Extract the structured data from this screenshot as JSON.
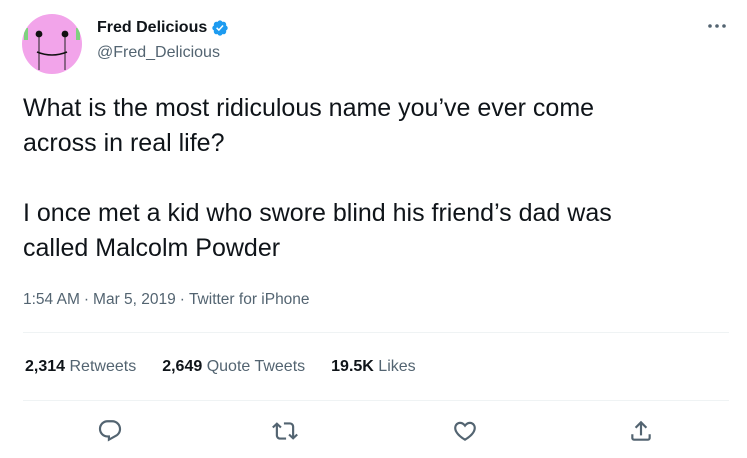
{
  "tweet": {
    "author": {
      "display_name": "Fred Delicious",
      "handle": "@Fred_Delicious",
      "verified": true,
      "avatar_icon": "pink-smiley-face-avatar"
    },
    "text": {
      "paragraph1": "What is the most ridiculous name you’ve ever come\nacross in real life?",
      "paragraph2": "I once met a kid who swore blind his friend’s dad was\ncalled Malcolm Powder"
    },
    "meta": {
      "time": "1:54 AM",
      "separator": "·",
      "date": "Mar 5, 2019",
      "source": "Twitter for iPhone"
    },
    "stats": {
      "retweets_count": "2,314",
      "retweets_label": "Retweets",
      "quote_tweets_count": "2,649",
      "quote_tweets_label": "Quote Tweets",
      "likes_count": "19.5K",
      "likes_label": "Likes"
    },
    "actions": [
      "reply-icon",
      "retweet-icon",
      "like-icon",
      "share-icon"
    ],
    "colors": {
      "verified_blue": "#1d9bf0",
      "text_primary": "#0f1419",
      "text_secondary": "#536471",
      "divider": "#eff3f4",
      "avatar_pink": "#f4a6e8"
    }
  }
}
